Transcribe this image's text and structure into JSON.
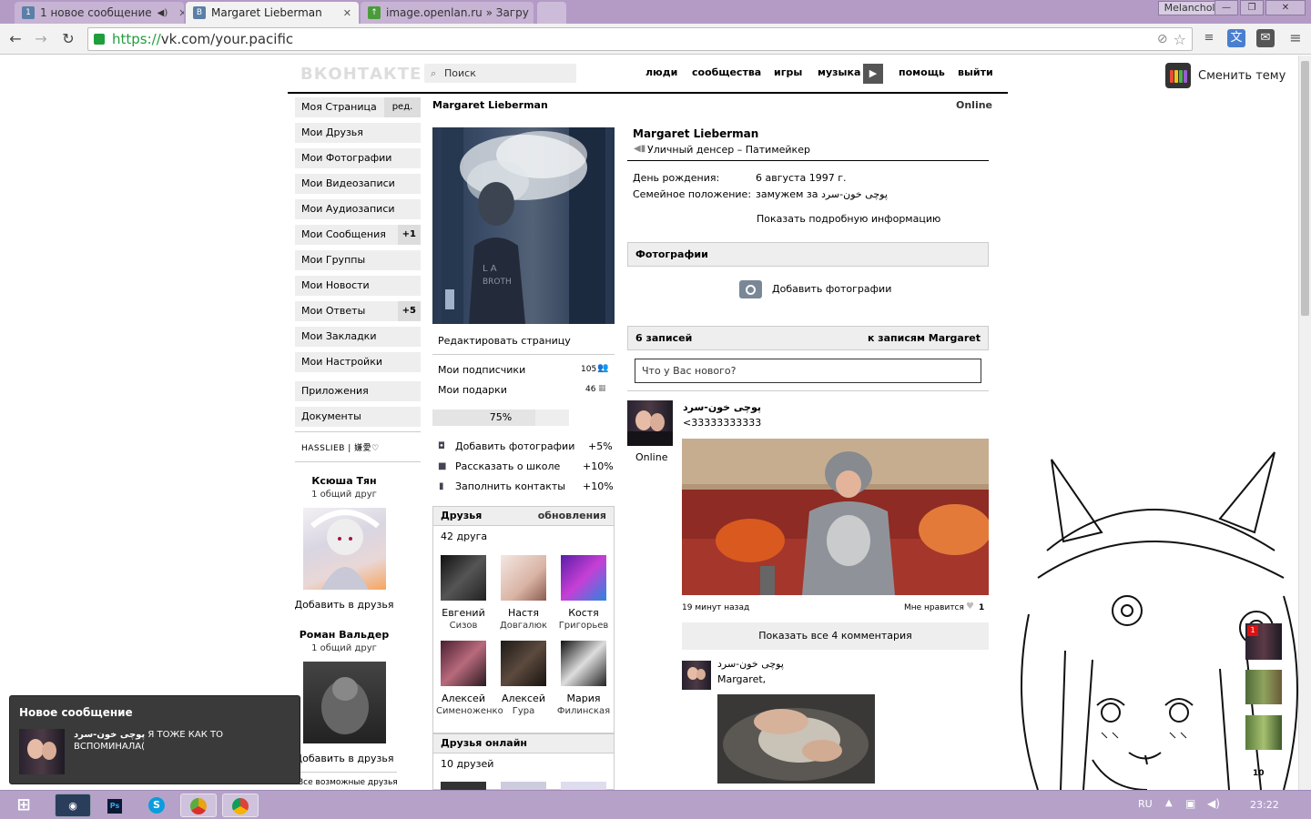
{
  "browser": {
    "tabs": [
      {
        "label": "1 новое сообщение",
        "fav": "1"
      },
      {
        "label": "Margaret Lieberman",
        "fav": "В"
      },
      {
        "label": "image.openlan.ru » Загру",
        "fav": "↑"
      }
    ],
    "user": "Melancholy",
    "url_scheme": "https://",
    "url_rest": "vk.com/your.pacific"
  },
  "vk": {
    "logo": "ВКОНТАКТЕ",
    "search_placeholder": "Поиск",
    "nav": [
      "люди",
      "сообщества",
      "игры",
      "музыка",
      "помощь",
      "выйти"
    ],
    "theme_label": "Сменить тему",
    "left_menu": [
      {
        "label": "Моя Страница",
        "extra": "ред."
      },
      {
        "label": "Мои Друзья"
      },
      {
        "label": "Мои Фотографии"
      },
      {
        "label": "Мои Видеозаписи"
      },
      {
        "label": "Мои Аудиозаписи"
      },
      {
        "label": "Мои Сообщения",
        "badge": "+1"
      },
      {
        "label": "Мои Группы"
      },
      {
        "label": "Мои Новости"
      },
      {
        "label": "Мои Ответы",
        "badge": "+5"
      },
      {
        "label": "Мои Закладки"
      },
      {
        "label": "Мои Настройки"
      }
    ],
    "left_menu2": [
      "Приложения",
      "Документы"
    ],
    "hasslieb": "HASSLIEB | 嫌愛♡",
    "suggested": [
      {
        "name": "Ксюша Тян",
        "mutual": "1 общий друг",
        "add": "Добавить в друзья"
      },
      {
        "name": "Роман Вальдер",
        "mutual": "1 общий друг",
        "add": "Добавить в друзья"
      }
    ],
    "all_friends_link": "Все возможные друзья"
  },
  "profile": {
    "name": "Margaret Lieberman",
    "online": "Online",
    "status": "Уличный денсер – Патимейкер",
    "birthday_label": "День рождения:",
    "birthday_value": "6 августа 1997 г.",
    "family_label": "Семейное положение:",
    "family_value": "замужем за پوچی خون-سرد",
    "show_more": "Показать подробную информацию",
    "edit_page": "Редактировать страницу",
    "subscribers_label": "Мои подписчики",
    "subscribers_count": "105",
    "gifts_label": "Мои подарки",
    "gifts_count": "46",
    "progress_text": "75%",
    "progress": 0.75,
    "tasks": [
      {
        "label": "Добавить фотографии",
        "pct": "+5%"
      },
      {
        "label": "Рассказать о школе",
        "pct": "+10%"
      },
      {
        "label": "Заполнить контакты",
        "pct": "+10%"
      }
    ],
    "friends_title": "Друзья",
    "friends_updates": "обновления",
    "friends_count": "42 друга",
    "friends": [
      {
        "first": "Евгений",
        "last": "Сизов"
      },
      {
        "first": "Настя",
        "last": "Довгалюк"
      },
      {
        "first": "Костя",
        "last": "Григорьев"
      },
      {
        "first": "Алексей",
        "last": "Сименоженко"
      },
      {
        "first": "Алексей",
        "last": "Гура"
      },
      {
        "first": "Мария",
        "last": "Филинская"
      }
    ],
    "friends_online_title": "Друзья онлайн",
    "friends_online_count": "10 друзей",
    "photos_title": "Фотографии",
    "add_photos": "Добавить фотографии",
    "wall_count": "6 записей",
    "wall_link": "к записям Margaret",
    "wall_placeholder": "Что у Вас нового?",
    "post": {
      "author": "پوچی خون-سرد",
      "text": "<33333333333",
      "online": "Online",
      "time": "19 минут назад",
      "like_label": "Мне нравится",
      "like_count": "1",
      "show_comments": "Показать все 4 комментария",
      "comment_author": "پوچی خون-سرد",
      "comment_text": "Margaret,"
    }
  },
  "toast": {
    "title": "Новое сообщение",
    "author": "پوچی خون-سرد",
    "text": "Я ТОЖЕ КАК ТО ВСПОМИНАЛА("
  },
  "right_dock": {
    "badge": "1",
    "count": "10"
  },
  "taskbar": {
    "lang": "RU",
    "time": "23:22"
  }
}
